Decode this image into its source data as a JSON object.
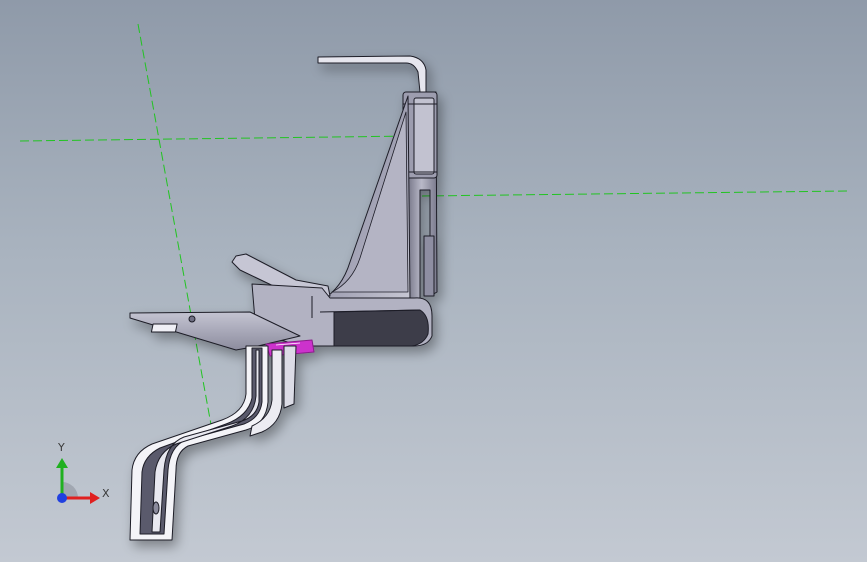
{
  "viewport": {
    "background_top": "#8f9aa9",
    "background_bottom": "#c3c9d2",
    "reference_line_color": "#22c422",
    "part_color": "#9a9aae",
    "highlight_color": "#cc33cc"
  },
  "triad": {
    "x_label": "X",
    "y_label": "Y",
    "x_color": "#e02020",
    "y_color": "#20b020",
    "z_color": "#2040e0"
  }
}
